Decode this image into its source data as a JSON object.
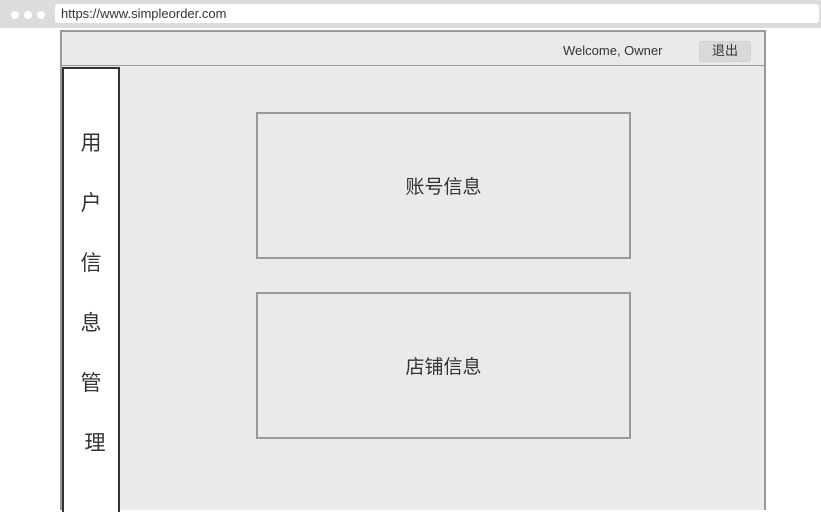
{
  "browser": {
    "url": "https://www.simpleorder.com"
  },
  "header": {
    "welcome_text": "Welcome, Owner",
    "logout_label": "退出"
  },
  "sidebar": {
    "title_chars": [
      "用",
      "户",
      "信",
      "息",
      "管",
      "理"
    ]
  },
  "cards": {
    "account_info": "账号信息",
    "store_info": "店铺信息"
  }
}
